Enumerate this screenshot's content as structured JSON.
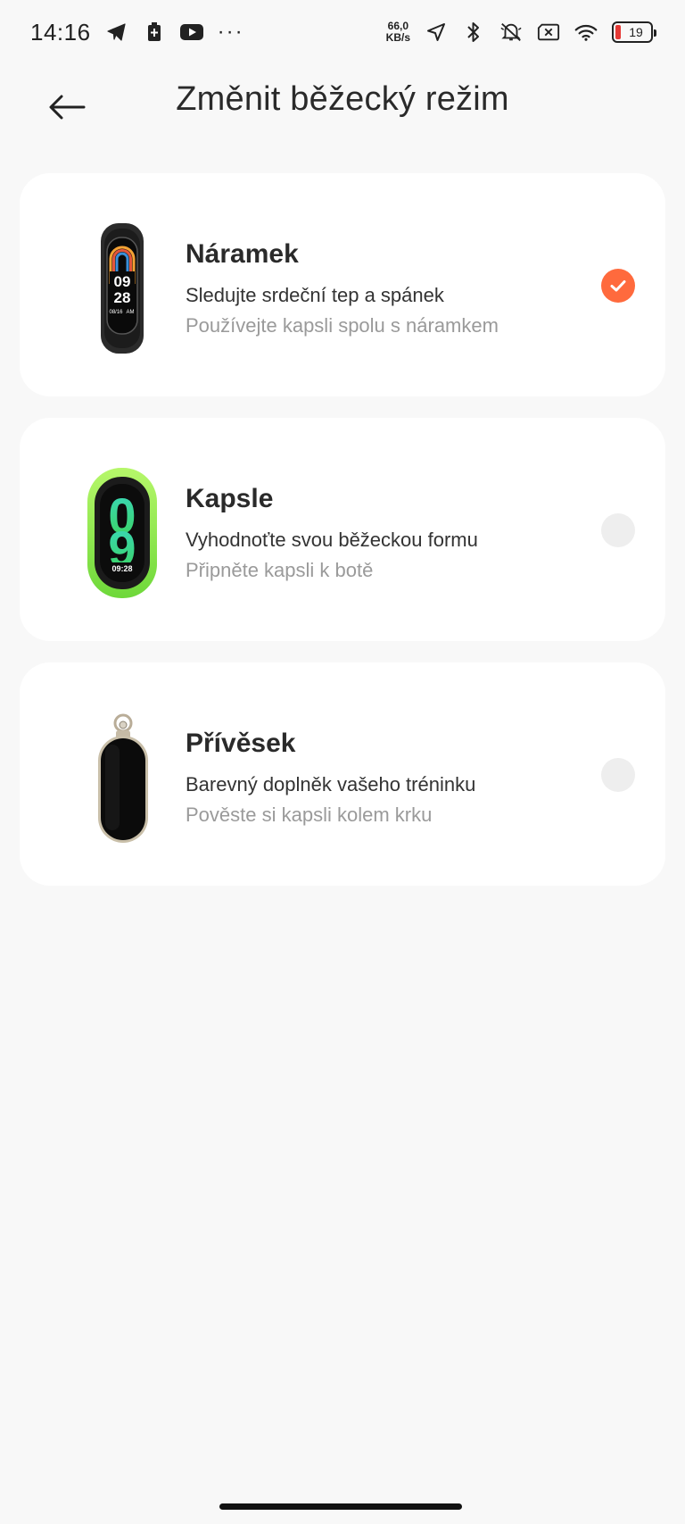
{
  "status_bar": {
    "time": "14:16",
    "net_speed_value": "66,0",
    "net_speed_unit": "KB/s",
    "battery_level": "19",
    "left_icons": [
      "telegram-icon",
      "battery-saver-icon",
      "youtube-icon",
      "more-dots-icon"
    ],
    "right_icons": [
      "location-icon",
      "bluetooth-icon",
      "mute-icon",
      "no-sim-icon",
      "wifi-icon",
      "battery-icon"
    ],
    "more_dots": "···"
  },
  "header": {
    "title": "Změnit běžecký režim",
    "back_icon": "back-arrow-icon"
  },
  "accent_color": "#ff6a3d",
  "options": [
    {
      "title": "Náramek",
      "description": "Sledujte srdeční tep a spánek",
      "hint": "Používejte kapsli spolu s náramkem",
      "selected": true,
      "image": "band-image"
    },
    {
      "title": "Kapsle",
      "description": "Vyhodnoťte svou běžeckou formu",
      "hint": "Připněte kapsli k botě",
      "selected": false,
      "image": "capsule-image"
    },
    {
      "title": "Přívěsek",
      "description": "Barevný doplněk vašeho tréninku",
      "hint": "Pověste si kapsli kolem krku",
      "selected": false,
      "image": "pendant-image"
    }
  ],
  "device_screen": {
    "hours": "09",
    "minutes": "28",
    "date": "08/16",
    "ampm": "AM",
    "small_time": "09:28",
    "big_digit": "9"
  }
}
